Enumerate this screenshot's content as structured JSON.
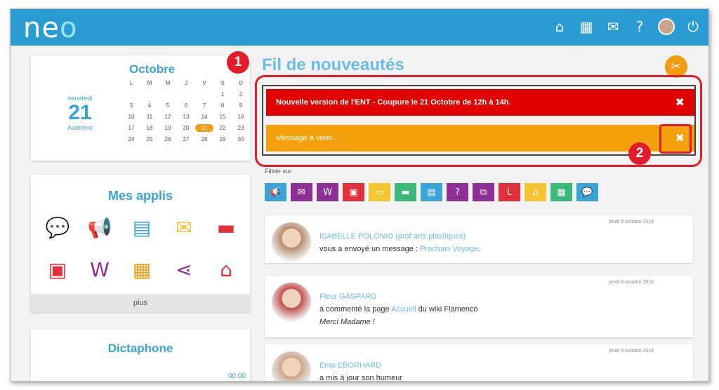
{
  "topbar": {
    "logo_main": "ne",
    "logo_accent": "o",
    "icons": [
      "home-icon",
      "apps-grid-icon",
      "mail-icon",
      "help-icon",
      "user-avatar",
      "power-icon"
    ]
  },
  "calendar": {
    "month": "Octobre",
    "weekday": "vendredi",
    "day": "21",
    "season": "Automne",
    "headers": [
      "L",
      "M",
      "M",
      "J",
      "V",
      "S",
      "D"
    ],
    "days": [
      "",
      "",
      "",
      "",
      "",
      "1",
      "2",
      "3",
      "4",
      "5",
      "6",
      "7",
      "8",
      "9",
      "10",
      "11",
      "12",
      "13",
      "14",
      "15",
      "16",
      "17",
      "18",
      "19",
      "20",
      "21",
      "22",
      "23",
      "24",
      "25",
      "26",
      "27",
      "28",
      "29",
      "30"
    ],
    "today_index": 25
  },
  "apps": {
    "title": "Mes applis",
    "items": [
      {
        "name": "messagerie-chat-icon",
        "glyph": "💬",
        "color": "#3aa4d8"
      },
      {
        "name": "megaphone-icon",
        "glyph": "📢",
        "color": "#f39c12"
      },
      {
        "name": "directory-icon",
        "glyph": "▤",
        "color": "#3aa4d8"
      },
      {
        "name": "mail-icon",
        "glyph": "✉",
        "color": "#f5c431"
      },
      {
        "name": "folder-icon",
        "glyph": "▬",
        "color": "#e0303a"
      },
      {
        "name": "workspace-icon",
        "glyph": "▣",
        "color": "#e0303a"
      },
      {
        "name": "wiki-icon",
        "glyph": "W",
        "color": "#8e2f95"
      },
      {
        "name": "calendar-icon",
        "glyph": "▦",
        "color": "#f39c12"
      },
      {
        "name": "share-icon",
        "glyph": "⋖",
        "color": "#8e2f95"
      },
      {
        "name": "inbox-icon",
        "glyph": "⌂",
        "color": "#e0303a"
      }
    ],
    "more_label": "plus"
  },
  "dictaphone": {
    "title": "Dictaphone",
    "time": "00:00"
  },
  "feed": {
    "title": "Fil de nouveautés",
    "filter_label": "Filtrer sur",
    "filters": [
      {
        "name": "filter-actualites",
        "glyph": "📢",
        "color": "#3aa4d8"
      },
      {
        "name": "filter-mail",
        "glyph": "✉",
        "color": "#8e2f95"
      },
      {
        "name": "filter-wiki",
        "glyph": "W",
        "color": "#8e2f95"
      },
      {
        "name": "filter-workspace",
        "glyph": "▣",
        "color": "#e0303a"
      },
      {
        "name": "filter-notes",
        "glyph": "▭",
        "color": "#f5c431"
      },
      {
        "name": "filter-folder",
        "glyph": "▬",
        "color": "#3cb878"
      },
      {
        "name": "filter-directory",
        "glyph": "▤",
        "color": "#3aa4d8"
      },
      {
        "name": "filter-help",
        "glyph": "?",
        "color": "#8e2f95"
      },
      {
        "name": "filter-org",
        "glyph": "⧉",
        "color": "#8e2f95"
      },
      {
        "name": "filter-timeline",
        "glyph": "L",
        "color": "#e0303a"
      },
      {
        "name": "filter-inbox",
        "glyph": "⌂",
        "color": "#f5c431"
      },
      {
        "name": "filter-forms",
        "glyph": "▦",
        "color": "#3cb878"
      },
      {
        "name": "filter-chat",
        "glyph": "💬",
        "color": "#3aa4d8"
      }
    ],
    "posts": [
      {
        "date": "jeudi 6 octobre 2016",
        "author": "ISABELLE POLONIO (prof arts plastiques)",
        "action": "vous a envoyé un message : ",
        "link": "Prochain Voyage",
        "suffix": ".",
        "line2": ""
      },
      {
        "date": "jeudi 6 octobre 2016",
        "author": "Fleur GASPARD",
        "action": "a commenté la page ",
        "link": "Accueil",
        "suffix": " du wiki Flamenco",
        "line2": "Merci Madame !"
      },
      {
        "date": "jeudi 6 octobre 2016",
        "author": "Ema EBORHARD",
        "action": "a mis à jour son humeur",
        "link": "",
        "suffix": "",
        "line2": ""
      }
    ]
  },
  "alerts": {
    "red_text": "Nouvelle version de l'ENT - Coupure le 21 Octobre de 12h à 14h.",
    "orange_text": "Message à venir...",
    "close_glyph": "✖"
  },
  "annotations": {
    "marker1": "1",
    "marker2": "2"
  }
}
